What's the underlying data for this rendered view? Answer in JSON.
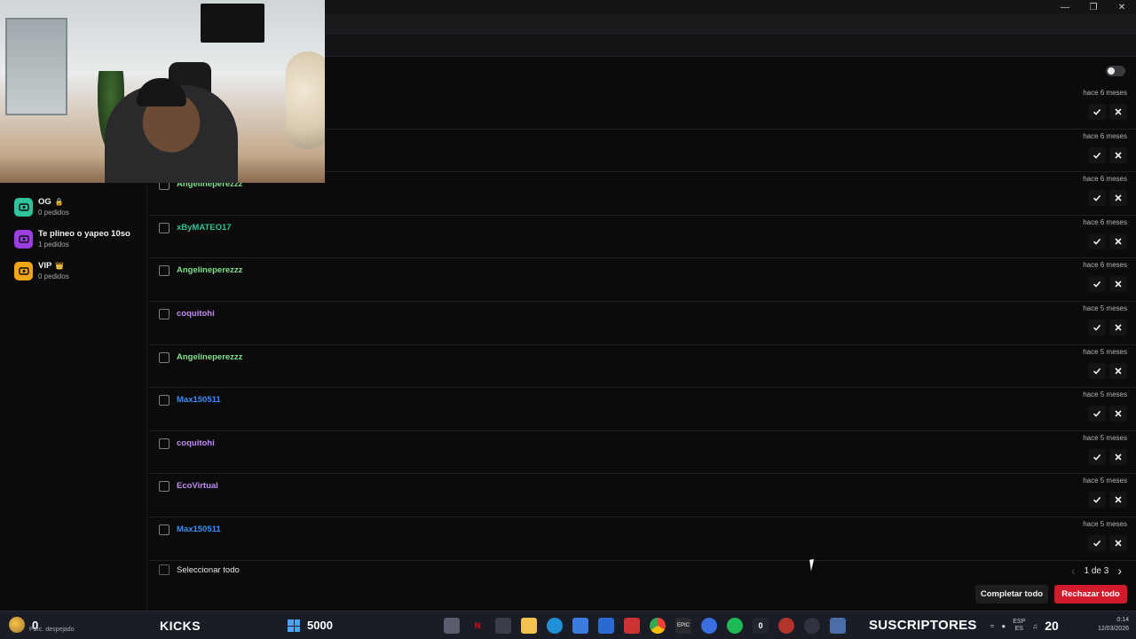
{
  "sidebar": {
    "categories": [
      {
        "name": "OG",
        "count": "0 pedidos",
        "color": "#2fc39a",
        "badge": "🔒"
      },
      {
        "name": "Te plineo o yapeo 10so",
        "count": "1 pedidos",
        "color": "#9b3fe0",
        "badge": ""
      },
      {
        "name": "VIP",
        "count": "0 pedidos",
        "color": "#f0a516",
        "badge": "👑"
      }
    ]
  },
  "requests": [
    {
      "user": "",
      "time": "hace 6 meses",
      "color": "#7ee08a"
    },
    {
      "user": "",
      "time": "hace 6 meses",
      "color": "#7ee08a"
    },
    {
      "user": "Angelineperezzz",
      "time": "hace 6 meses",
      "color": "#7ee08a"
    },
    {
      "user": "xByMATEO17",
      "time": "hace 6 meses",
      "color": "#2fc39a"
    },
    {
      "user": "Angelineperezzz",
      "time": "hace 6 meses",
      "color": "#7ee08a"
    },
    {
      "user": "coquitohi",
      "time": "hace 5 meses",
      "color": "#c08cf5"
    },
    {
      "user": "Angelineperezzz",
      "time": "hace 5 meses",
      "color": "#7ee08a"
    },
    {
      "user": "Max150511",
      "time": "hace 5 meses",
      "color": "#3d8ef5"
    },
    {
      "user": "coquitohi",
      "time": "hace 5 meses",
      "color": "#c08cf5"
    },
    {
      "user": "EcoVirtual",
      "time": "hace 5 meses",
      "color": "#c08cf5"
    },
    {
      "user": "Max150511",
      "time": "hace 5 meses",
      "color": "#3d8ef5"
    }
  ],
  "footer": {
    "select_all": "Seleccionar todo",
    "page": "1 de 3",
    "complete_all": "Completar todo",
    "reject_all": "Rechazar todo"
  },
  "taskbar": {
    "left_counter": "0",
    "weather": "Parc. despejado",
    "kicks": "KICKS",
    "goal": "5000",
    "subs": "SUSCRIPTORES",
    "subs_count": "20",
    "lang_top": "ESP",
    "lang_bottom": "ES",
    "time": "0:14",
    "date": "12/03/2026",
    "app_badge": "0"
  }
}
